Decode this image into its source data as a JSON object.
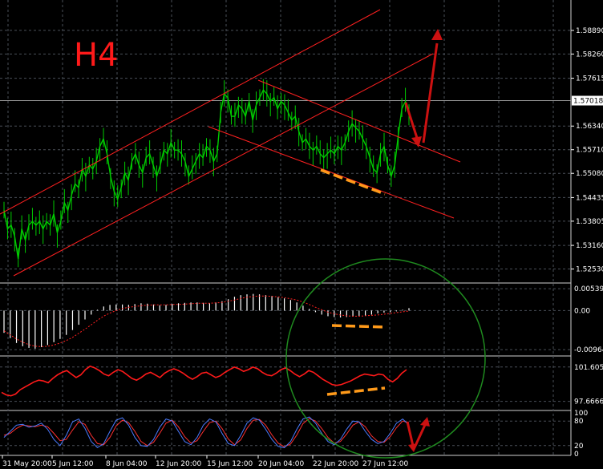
{
  "timeframe": "H4",
  "colors": {
    "background": "#000000",
    "grid": "#4a4f58",
    "text": "#ffffff",
    "candles": "#00cc00",
    "channels": "#ff2020",
    "histogram": "#ffffff",
    "signal": "#ff2020",
    "indicator2": "#ff1a1a",
    "stoch_main": "#4a7bff",
    "stoch_signal": "#ff3030",
    "arrows": "#cc1111",
    "divergence": "#ff9a1a",
    "circle": "#1f8a1f",
    "bid_line": "#9a9a9a"
  },
  "chart_data": [
    {
      "type": "line",
      "panel": "price",
      "title": "H4",
      "x_tick_labels": [
        "31 May 20:00",
        "5 Jun 12:00",
        "8 Jun 04:00",
        "12 Jun 20:00",
        "15 Jun 12:00",
        "20 Jun 04:00",
        "22 Jun 20:00",
        "27 Jun 12:00"
      ],
      "y_tick_labels": [
        "1.58890",
        "1.58260",
        "1.57615",
        "1.56340",
        "1.55710",
        "1.55080",
        "1.54435",
        "1.53805",
        "1.53160",
        "1.52530"
      ],
      "current_price_label": "1.57018",
      "ylim": [
        1.522,
        1.597
      ],
      "close_series": [
        1.541,
        1.536,
        1.537,
        1.534,
        1.528,
        1.536,
        1.533,
        1.537,
        1.538,
        1.537,
        1.538,
        1.536,
        1.538,
        1.537,
        1.54,
        1.535,
        1.538,
        1.543,
        1.541,
        1.545,
        1.548,
        1.547,
        1.552,
        1.55,
        1.553,
        1.552,
        1.554,
        1.558,
        1.56,
        1.556,
        1.55,
        1.546,
        1.544,
        1.547,
        1.551,
        1.549,
        1.554,
        1.556,
        1.553,
        1.551,
        1.555,
        1.556,
        1.553,
        1.55,
        1.553,
        1.557,
        1.556,
        1.559,
        1.557,
        1.557,
        1.556,
        1.554,
        1.55,
        1.552,
        1.554,
        1.556,
        1.555,
        1.558,
        1.557,
        1.554,
        1.556,
        1.567,
        1.572,
        1.571,
        1.566,
        1.566,
        1.569,
        1.568,
        1.566,
        1.57,
        1.565,
        1.569,
        1.571,
        1.573,
        1.572,
        1.57,
        1.571,
        1.568,
        1.57,
        1.569,
        1.567,
        1.565,
        1.566,
        1.562,
        1.559,
        1.56,
        1.558,
        1.557,
        1.558,
        1.556,
        1.555,
        1.556,
        1.557,
        1.556,
        1.558,
        1.557,
        1.559,
        1.562,
        1.564,
        1.563,
        1.562,
        1.56,
        1.558,
        1.555,
        1.552,
        1.551,
        1.556,
        1.558,
        1.553,
        1.55,
        1.553,
        1.561,
        1.568,
        1.57,
        1.567
      ],
      "annotations": [
        "ascending channel",
        "descending channel",
        "forecast arrows",
        "divergence line"
      ]
    },
    {
      "type": "bar",
      "panel": "histogram",
      "y_tick_labels": [
        "0.005390",
        "0.00",
        "-0.00964"
      ],
      "ylim": [
        -0.0108,
        0.0062
      ],
      "values": [
        -0.0055,
        -0.0068,
        -0.008,
        -0.0088,
        -0.0092,
        -0.0094,
        -0.009,
        -0.0085,
        -0.0078,
        -0.007,
        -0.006,
        -0.0048,
        -0.0035,
        -0.0022,
        -0.001,
        0.0002,
        0.001,
        0.0014,
        0.0015,
        0.0015,
        0.0014,
        0.0016,
        0.0018,
        0.0017,
        0.0015,
        0.0013,
        0.0014,
        0.0016,
        0.0018,
        0.0019,
        0.002,
        0.002,
        0.0019,
        0.0018,
        0.002,
        0.0023,
        0.0028,
        0.0034,
        0.0038,
        0.004,
        0.0041,
        0.004,
        0.0038,
        0.0036,
        0.0033,
        0.003,
        0.0026,
        0.002,
        0.0012,
        0.0004,
        -0.0004,
        -0.001,
        -0.0014,
        -0.0016,
        -0.0017,
        -0.0016,
        -0.0015,
        -0.0013,
        -0.0012,
        -0.001,
        -0.0007,
        -0.0005,
        -0.0004,
        -0.0002,
        0.0002,
        0.0006
      ],
      "signal": [
        -0.005,
        -0.006,
        -0.007,
        -0.0078,
        -0.0084,
        -0.0088,
        -0.0089,
        -0.0088,
        -0.0085,
        -0.008,
        -0.0074,
        -0.0066,
        -0.0056,
        -0.0046,
        -0.0035,
        -0.0024,
        -0.0014,
        -0.0006,
        0.0,
        0.0005,
        0.0008,
        0.001,
        0.0012,
        0.0013,
        0.0014,
        0.0014,
        0.0014,
        0.0015,
        0.0015,
        0.0016,
        0.0017,
        0.0018,
        0.0018,
        0.0018,
        0.0019,
        0.002,
        0.0023,
        0.0026,
        0.003,
        0.0033,
        0.0035,
        0.0036,
        0.0036,
        0.0035,
        0.0034,
        0.0032,
        0.0029,
        0.0026,
        0.0021,
        0.0015,
        0.0008,
        0.0002,
        -0.0004,
        -0.0008,
        -0.0011,
        -0.0013,
        -0.0014,
        -0.0014,
        -0.0013,
        -0.0012,
        -0.0011,
        -0.0009,
        -0.0007,
        -0.0005,
        -0.0003,
        -0.0001
      ]
    },
    {
      "type": "line",
      "panel": "indicator",
      "y_tick_labels": [
        "101.6053",
        "97.6666"
      ],
      "ylim": [
        96.8,
        102.6
      ],
      "values": [
        98.7,
        98.4,
        98.3,
        98.5,
        99.0,
        99.3,
        99.6,
        99.9,
        100.1,
        100.0,
        99.8,
        100.3,
        100.7,
        101.0,
        101.2,
        100.8,
        100.4,
        100.7,
        101.3,
        101.7,
        101.5,
        101.2,
        100.8,
        100.6,
        101.0,
        101.3,
        101.1,
        100.7,
        100.3,
        100.1,
        100.4,
        100.8,
        101.0,
        100.7,
        100.4,
        100.9,
        101.2,
        101.4,
        101.2,
        100.9,
        100.5,
        100.2,
        100.5,
        100.9,
        101.0,
        100.7,
        100.4,
        100.6,
        101.0,
        101.3,
        101.6,
        101.4,
        101.1,
        101.3,
        101.6,
        101.4,
        101.0,
        100.7,
        100.6,
        100.9,
        101.3,
        101.5,
        101.2,
        100.8,
        100.5,
        100.8,
        101.2,
        101.0,
        100.6,
        100.2,
        99.9,
        99.6,
        99.5,
        99.6,
        99.8,
        100.0,
        100.3,
        100.6,
        100.8,
        100.7,
        100.6,
        100.8,
        100.7,
        100.2,
        99.9,
        100.3,
        100.9,
        101.3
      ]
    },
    {
      "type": "line",
      "panel": "stochastic",
      "y_tick_labels": [
        "100",
        "80",
        "20",
        "0"
      ],
      "ylim": [
        0,
        100
      ],
      "main": [
        40,
        55,
        70,
        72,
        65,
        68,
        75,
        60,
        35,
        20,
        45,
        78,
        85,
        62,
        30,
        15,
        25,
        55,
        82,
        88,
        70,
        40,
        20,
        18,
        35,
        65,
        85,
        80,
        55,
        30,
        22,
        40,
        70,
        85,
        78,
        50,
        25,
        20,
        45,
        75,
        88,
        82,
        60,
        35,
        18,
        15,
        30,
        60,
        85,
        90,
        75,
        50,
        30,
        22,
        35,
        60,
        80,
        78,
        55,
        35,
        25,
        30,
        50,
        75,
        85,
        70
      ],
      "signal": [
        45,
        50,
        62,
        70,
        68,
        66,
        70,
        66,
        50,
        32,
        35,
        58,
        78,
        72,
        45,
        25,
        22,
        40,
        68,
        82,
        76,
        55,
        30,
        20,
        28,
        50,
        75,
        82,
        66,
        42,
        26,
        32,
        55,
        76,
        80,
        62,
        36,
        22,
        34,
        62,
        82,
        84,
        70,
        46,
        26,
        17,
        24,
        46,
        74,
        86,
        80,
        62,
        40,
        26,
        30,
        48,
        70,
        78,
        66,
        44,
        30,
        28,
        42,
        64,
        80,
        76
      ]
    }
  ]
}
